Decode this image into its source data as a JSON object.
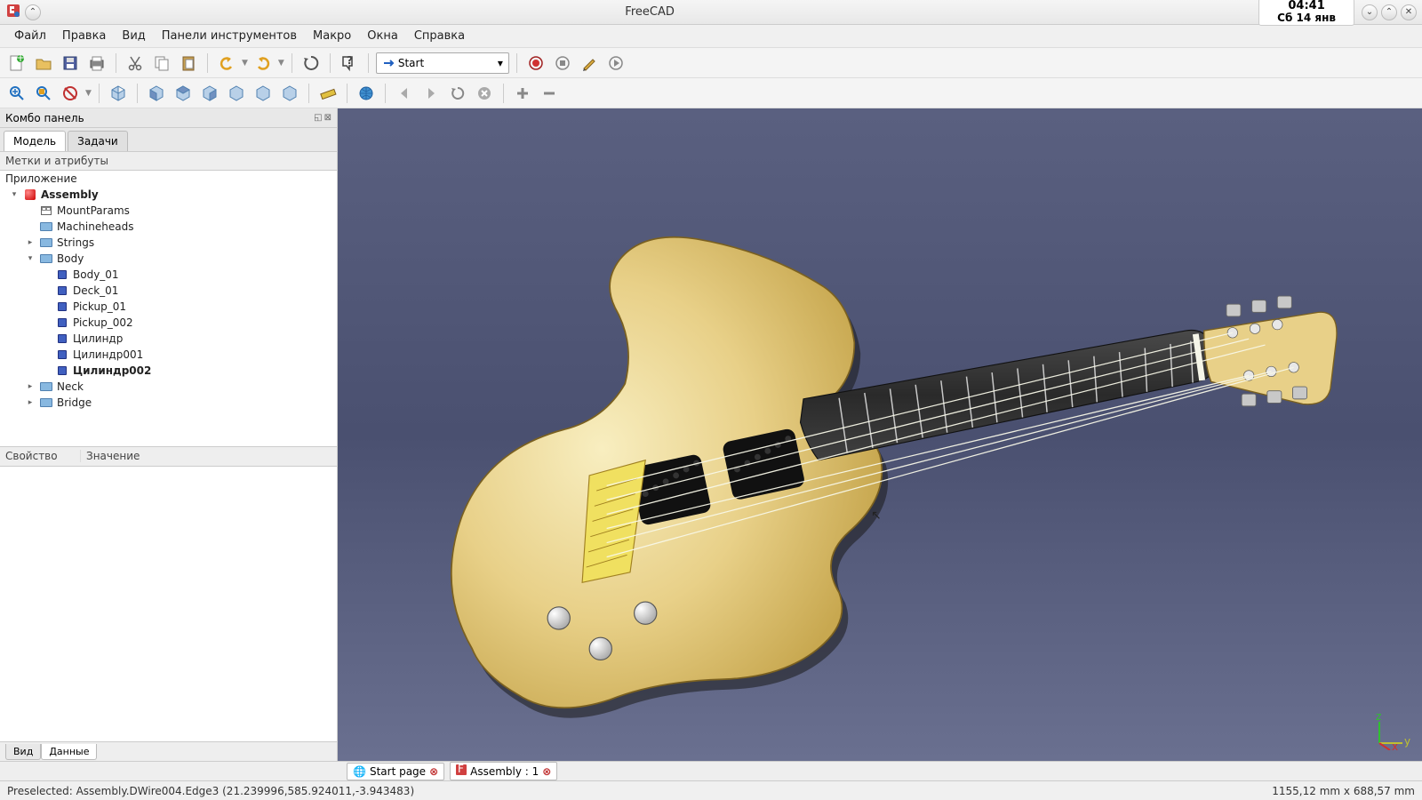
{
  "title": "FreeCAD",
  "clock": {
    "time": "04:41",
    "date": "Сб 14 янв"
  },
  "menu": [
    "Файл",
    "Правка",
    "Вид",
    "Панели инструментов",
    "Макро",
    "Окна",
    "Справка"
  ],
  "workbench_selected": "Start",
  "side_panel": {
    "title": "Комбо панель",
    "tabs": [
      {
        "label": "Модель",
        "active": true
      },
      {
        "label": "Задачи",
        "active": false
      }
    ],
    "tree_header": "Метки и атрибуты",
    "root": "Приложение",
    "tree": [
      {
        "depth": 0,
        "twisty": "▾",
        "icon": "asm",
        "label": "Assembly",
        "bold": true
      },
      {
        "depth": 1,
        "twisty": "",
        "icon": "sheet",
        "label": "MountParams"
      },
      {
        "depth": 1,
        "twisty": "",
        "icon": "folder",
        "label": "Machineheads"
      },
      {
        "depth": 1,
        "twisty": "▸",
        "icon": "folder",
        "label": "Strings"
      },
      {
        "depth": 1,
        "twisty": "▾",
        "icon": "folder",
        "label": "Body"
      },
      {
        "depth": 2,
        "twisty": "",
        "icon": "box",
        "label": "Body_01"
      },
      {
        "depth": 2,
        "twisty": "",
        "icon": "box",
        "label": "Deck_01"
      },
      {
        "depth": 2,
        "twisty": "",
        "icon": "box",
        "label": "Pickup_01"
      },
      {
        "depth": 2,
        "twisty": "",
        "icon": "box",
        "label": "Pickup_002"
      },
      {
        "depth": 2,
        "twisty": "",
        "icon": "box",
        "label": "Цилиндр"
      },
      {
        "depth": 2,
        "twisty": "",
        "icon": "box",
        "label": "Цилиндр001"
      },
      {
        "depth": 2,
        "twisty": "",
        "icon": "box",
        "label": "Цилиндр002",
        "bold": true
      },
      {
        "depth": 1,
        "twisty": "▸",
        "icon": "folder",
        "label": "Neck"
      },
      {
        "depth": 1,
        "twisty": "▸",
        "icon": "folder",
        "label": "Bridge"
      }
    ],
    "prop_cols": {
      "c1": "Свойство",
      "c2": "Значение"
    },
    "bottom_tabs": [
      {
        "label": "Вид",
        "active": false
      },
      {
        "label": "Данные",
        "active": true
      }
    ]
  },
  "doc_tabs": [
    {
      "label": "Start page",
      "icon": "world"
    },
    {
      "label": "Assembly : 1",
      "icon": "fc"
    }
  ],
  "status": {
    "left": "Preselected: Assembly.DWire004.Edge3 (21.239996,585.924011,-3.943483)",
    "right": "1155,12 mm x 688,57 mm"
  }
}
